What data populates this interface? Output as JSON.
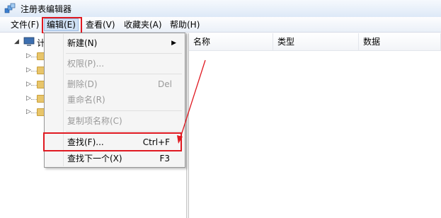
{
  "window": {
    "title": "注册表编辑器",
    "icon": "registry-editor-icon"
  },
  "menubar": {
    "items": [
      "文件(F)",
      "编辑(E)",
      "查看(V)",
      "收藏夹(A)",
      "帮助(H)"
    ]
  },
  "tree": {
    "root_label": "计"
  },
  "list": {
    "columns": [
      "名称",
      "类型",
      "数据"
    ]
  },
  "edit_menu": {
    "new": {
      "label": "新建(N)"
    },
    "permissions": {
      "label": "权限(P)..."
    },
    "delete": {
      "label": "删除(D)",
      "shortcut": "Del"
    },
    "rename": {
      "label": "重命名(R)"
    },
    "copy_key_name": {
      "label": "复制项名称(C)"
    },
    "find": {
      "label": "查找(F)...",
      "shortcut": "Ctrl+F"
    },
    "find_next": {
      "label": "查找下一个(X)",
      "shortcut": "F3"
    }
  },
  "colors": {
    "highlight": "#e01921",
    "folder": "#e8c56a"
  }
}
